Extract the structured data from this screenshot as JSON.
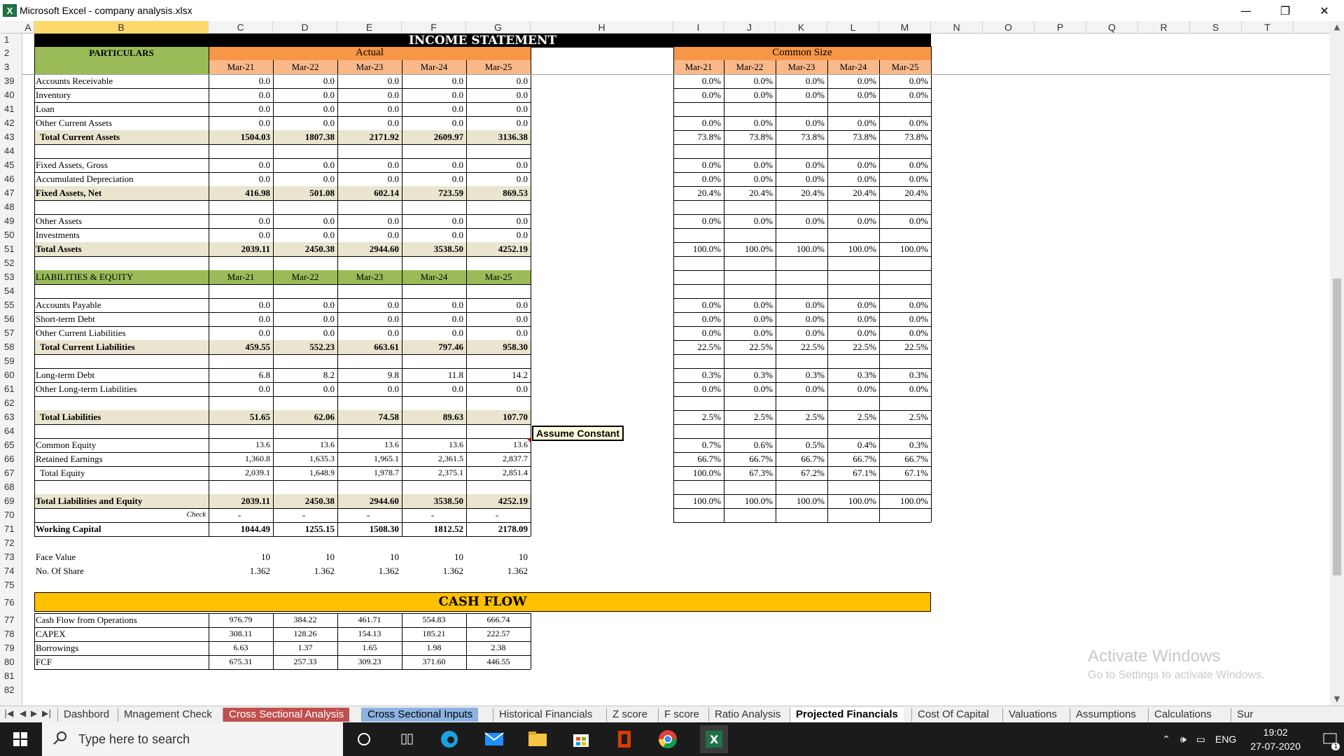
{
  "window": {
    "title": "Microsoft Excel - company analysis.xlsx",
    "icon_letter": "X",
    "minimize": "—",
    "restore": "❐",
    "close": "✕"
  },
  "column_headers": [
    "A",
    "B",
    "C",
    "D",
    "E",
    "F",
    "G",
    "H",
    "I",
    "J",
    "K",
    "L",
    "M",
    "N",
    "O",
    "P",
    "Q",
    "R",
    "S",
    "T"
  ],
  "row_numbers": [
    "1",
    "2",
    "3",
    "39",
    "40",
    "41",
    "42",
    "43",
    "44",
    "45",
    "46",
    "47",
    "48",
    "49",
    "50",
    "51",
    "52",
    "53",
    "54",
    "55",
    "56",
    "57",
    "58",
    "59",
    "60",
    "61",
    "62",
    "63",
    "64",
    "65",
    "66",
    "67",
    "68",
    "69",
    "70",
    "71",
    "72",
    "73",
    "74",
    "75",
    "76",
    "77",
    "78",
    "79",
    "80",
    "81",
    "82"
  ],
  "sheet": {
    "banner_income": "INCOME STATEMENT",
    "banner_cash": "CASH FLOW",
    "particulars": "PARTICULARS",
    "actual": "Actual",
    "common_size": "Common Size",
    "years": [
      "Mar-21",
      "Mar-22",
      "Mar-23",
      "Mar-24",
      "Mar-25"
    ],
    "comment": "Assume Constant",
    "check_label": "Check",
    "rows": [
      {
        "label": "Accounts Receivable",
        "vals": [
          "0.0",
          "0.0",
          "0.0",
          "0.0",
          "0.0"
        ],
        "cs": [
          "0.0%",
          "0.0%",
          "0.0%",
          "0.0%",
          "0.0%"
        ]
      },
      {
        "label": "Inventory",
        "vals": [
          "0.0",
          "0.0",
          "0.0",
          "0.0",
          "0.0"
        ],
        "cs": [
          "0.0%",
          "0.0%",
          "0.0%",
          "0.0%",
          "0.0%"
        ]
      },
      {
        "label": "Loan",
        "vals": [
          "0.0",
          "0.0",
          "0.0",
          "0.0",
          "0.0"
        ],
        "cs": [
          "",
          "",
          "",
          "",
          ""
        ]
      },
      {
        "label": "Other Current Assets",
        "vals": [
          "0.0",
          "0.0",
          "0.0",
          "0.0",
          "0.0"
        ],
        "cs": [
          "0.0%",
          "0.0%",
          "0.0%",
          "0.0%",
          "0.0%"
        ]
      },
      {
        "label": "Total Current Assets",
        "vals": [
          "1504.03",
          "1807.38",
          "2171.92",
          "2609.97",
          "3136.38"
        ],
        "cs": [
          "73.8%",
          "73.8%",
          "73.8%",
          "73.8%",
          "73.8%"
        ]
      },
      {
        "label": "",
        "vals": [
          "",
          "",
          "",
          "",
          ""
        ],
        "cs": [
          "",
          "",
          "",
          "",
          ""
        ]
      },
      {
        "label": "Fixed Assets, Gross",
        "vals": [
          "0.0",
          "0.0",
          "0.0",
          "0.0",
          "0.0"
        ],
        "cs": [
          "0.0%",
          "0.0%",
          "0.0%",
          "0.0%",
          "0.0%"
        ]
      },
      {
        "label": "Accumulated Depreciation",
        "vals": [
          "0.0",
          "0.0",
          "0.0",
          "0.0",
          "0.0"
        ],
        "cs": [
          "0.0%",
          "0.0%",
          "0.0%",
          "0.0%",
          "0.0%"
        ]
      },
      {
        "label": "Fixed Assets, Net",
        "vals": [
          "416.98",
          "501.08",
          "602.14",
          "723.59",
          "869.53"
        ],
        "cs": [
          "20.4%",
          "20.4%",
          "20.4%",
          "20.4%",
          "20.4%"
        ]
      },
      {
        "label": "",
        "vals": [
          "",
          "",
          "",
          "",
          ""
        ],
        "cs": [
          "",
          "",
          "",
          "",
          ""
        ]
      },
      {
        "label": "Other Assets",
        "vals": [
          "0.0",
          "0.0",
          "0.0",
          "0.0",
          "0.0"
        ],
        "cs": [
          "0.0%",
          "0.0%",
          "0.0%",
          "0.0%",
          "0.0%"
        ]
      },
      {
        "label": "Investments",
        "vals": [
          "0.0",
          "0.0",
          "0.0",
          "0.0",
          "0.0"
        ],
        "cs": [
          "",
          "",
          "",
          "",
          ""
        ]
      },
      {
        "label": "Total Assets",
        "vals": [
          "2039.11",
          "2450.38",
          "2944.60",
          "3538.50",
          "4252.19"
        ],
        "cs": [
          "100.0%",
          "100.0%",
          "100.0%",
          "100.0%",
          "100.0%"
        ]
      },
      {
        "label": "",
        "vals": [
          "",
          "",
          "",
          "",
          ""
        ],
        "cs": [
          "",
          "",
          "",
          "",
          ""
        ]
      },
      {
        "label": "LIABILITIES & EQUITY",
        "vals": [
          "Mar-21",
          "Mar-22",
          "Mar-23",
          "Mar-24",
          "Mar-25"
        ],
        "cs": [
          "",
          "",
          "",
          "",
          ""
        ]
      },
      {
        "label": "",
        "vals": [
          "",
          "",
          "",
          "",
          ""
        ],
        "cs": [
          "",
          "",
          "",
          "",
          ""
        ]
      },
      {
        "label": "Accounts Payable",
        "vals": [
          "0.0",
          "0.0",
          "0.0",
          "0.0",
          "0.0"
        ],
        "cs": [
          "0.0%",
          "0.0%",
          "0.0%",
          "0.0%",
          "0.0%"
        ]
      },
      {
        "label": "Short-term Debt",
        "vals": [
          "0.0",
          "0.0",
          "0.0",
          "0.0",
          "0.0"
        ],
        "cs": [
          "0.0%",
          "0.0%",
          "0.0%",
          "0.0%",
          "0.0%"
        ]
      },
      {
        "label": "Other Current Liabilities",
        "vals": [
          "0.0",
          "0.0",
          "0.0",
          "0.0",
          "0.0"
        ],
        "cs": [
          "0.0%",
          "0.0%",
          "0.0%",
          "0.0%",
          "0.0%"
        ]
      },
      {
        "label": "Total Current Liabilities",
        "vals": [
          "459.55",
          "552.23",
          "663.61",
          "797.46",
          "958.30"
        ],
        "cs": [
          "22.5%",
          "22.5%",
          "22.5%",
          "22.5%",
          "22.5%"
        ]
      },
      {
        "label": "",
        "vals": [
          "",
          "",
          "",
          "",
          ""
        ],
        "cs": [
          "",
          "",
          "",
          "",
          ""
        ]
      },
      {
        "label": "Long-term Debt",
        "vals": [
          "6.8",
          "8.2",
          "9.8",
          "11.8",
          "14.2"
        ],
        "cs": [
          "0.3%",
          "0.3%",
          "0.3%",
          "0.3%",
          "0.3%"
        ]
      },
      {
        "label": "Other Long-term Liabilities",
        "vals": [
          "0.0",
          "0.0",
          "0.0",
          "0.0",
          "0.0"
        ],
        "cs": [
          "0.0%",
          "0.0%",
          "0.0%",
          "0.0%",
          "0.0%"
        ]
      },
      {
        "label": "",
        "vals": [
          "",
          "",
          "",
          "",
          ""
        ],
        "cs": [
          "",
          "",
          "",
          "",
          ""
        ]
      },
      {
        "label": "Total Liabilities",
        "vals": [
          "51.65",
          "62.06",
          "74.58",
          "89.63",
          "107.70"
        ],
        "cs": [
          "2.5%",
          "2.5%",
          "2.5%",
          "2.5%",
          "2.5%"
        ]
      },
      {
        "label": "",
        "vals": [
          "",
          "",
          "",
          "",
          ""
        ],
        "cs": [
          "",
          "",
          "",
          "",
          ""
        ]
      },
      {
        "label": "Common Equity",
        "vals": [
          "13.6",
          "13.6",
          "13.6",
          "13.6",
          "13.6"
        ],
        "cs": [
          "0.7%",
          "0.6%",
          "0.5%",
          "0.4%",
          "0.3%"
        ]
      },
      {
        "label": "Retained Earnings",
        "vals": [
          "1,360.8",
          "1,635.3",
          "1,965.1",
          "2,361.5",
          "2,837.7"
        ],
        "cs": [
          "66.7%",
          "66.7%",
          "66.7%",
          "66.7%",
          "66.7%"
        ]
      },
      {
        "label": "Total Equity",
        "vals": [
          "2,039.1",
          "1,648.9",
          "1,978.7",
          "2,375.1",
          "2,851.4"
        ],
        "cs": [
          "100.0%",
          "67.3%",
          "67.2%",
          "67.1%",
          "67.1%"
        ]
      },
      {
        "label": "",
        "vals": [
          "",
          "",
          "",
          "",
          ""
        ],
        "cs": [
          "",
          "",
          "",
          "",
          ""
        ]
      },
      {
        "label": "Total Liabilities and Equity",
        "vals": [
          "2039.11",
          "2450.38",
          "2944.60",
          "3538.50",
          "4252.19"
        ],
        "cs": [
          "100.0%",
          "100.0%",
          "100.0%",
          "100.0%",
          "100.0%"
        ]
      },
      {
        "label": "",
        "vals": [
          "-",
          "-",
          "-",
          "-",
          "-"
        ],
        "cs": [
          "",
          "",
          "",
          "",
          ""
        ]
      },
      {
        "label": "Working Capital",
        "vals": [
          "1044.49",
          "1255.15",
          "1508.30",
          "1812.52",
          "2178.09"
        ],
        "cs": null
      },
      {
        "label": "",
        "vals": [
          "",
          "",
          "",
          "",
          ""
        ],
        "cs": null
      },
      {
        "label": "Face Value",
        "vals": [
          "10",
          "10",
          "10",
          "10",
          "10"
        ],
        "cs": null
      },
      {
        "label": "No. Of Share",
        "vals": [
          "1.362",
          "1.362",
          "1.362",
          "1.362",
          "1.362"
        ],
        "cs": null
      }
    ],
    "cashflow": [
      {
        "label": "Cash Flow from Operations",
        "vals": [
          "976.79",
          "384.22",
          "461.71",
          "554.83",
          "666.74"
        ]
      },
      {
        "label": "CAPEX",
        "vals": [
          "308.11",
          "128.26",
          "154.13",
          "185.21",
          "222.57"
        ]
      },
      {
        "label": "Borrowings",
        "vals": [
          "6.63",
          "1.37",
          "1.65",
          "1.98",
          "2.38"
        ]
      },
      {
        "label": "FCF",
        "vals": [
          "675.31",
          "257.33",
          "309.23",
          "371.60",
          "446.55"
        ]
      }
    ]
  },
  "tabs": [
    "Dashbord",
    "Mnagement Check",
    "Cross Sectional Analysis",
    "Cross Sectional Inputs",
    "Historical Financials",
    "Z score",
    "F score",
    "Ratio Analysis",
    "Projected Financials",
    "Cost Of Capital",
    "Valuations",
    "Assumptions",
    "Calculations",
    "Sur"
  ],
  "active_tab": "Projected Financials",
  "watermark": {
    "line1": "Activate Windows",
    "line2": "Go to Settings to activate Windows."
  },
  "taskbar": {
    "search_placeholder": "Type here to search",
    "lang": "ENG",
    "time": "19:02",
    "date": "27-07-2020",
    "notif_count": "1"
  }
}
